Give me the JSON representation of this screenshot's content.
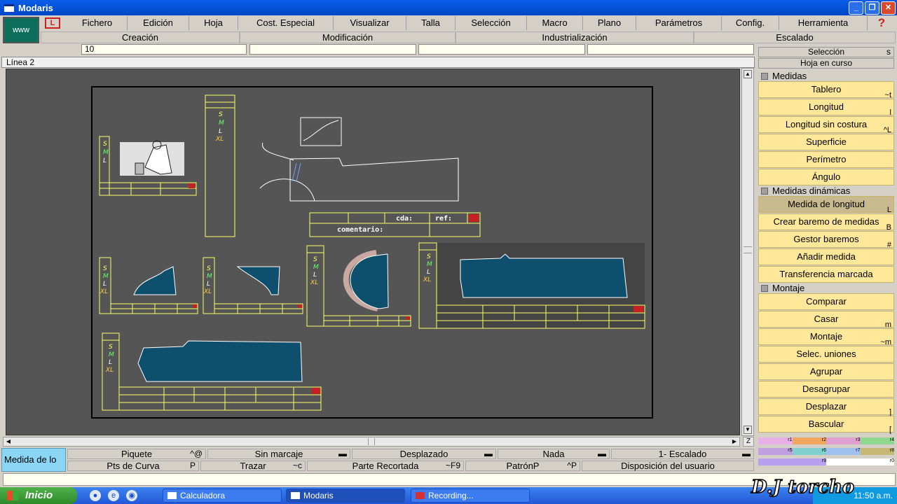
{
  "window": {
    "title": "Modaris",
    "www_label": "www",
    "lectra_glyph": "L"
  },
  "menu": [
    "Fichero",
    "Edición",
    "Hoja",
    "Cost. Especial",
    "Visualizar",
    "Talla",
    "Selección",
    "Macro",
    "Plano",
    "Parámetros",
    "Config.",
    "Herramienta"
  ],
  "help_glyph": "?",
  "submenu": [
    "Creación",
    "Modificación",
    "Industrialización",
    "Escalado"
  ],
  "fields": [
    "10",
    "",
    "",
    "",
    ""
  ],
  "line_label": "Línea 2",
  "right_panel": {
    "selection_label": "Selección",
    "selection_shortcut": "s",
    "sheet_label": "Hoja en curso",
    "sections": [
      {
        "title": "Medidas",
        "items": [
          {
            "label": "Tablero",
            "shortcut": "~t"
          },
          {
            "label": "Longitud",
            "shortcut": "l"
          },
          {
            "label": "Longitud sin costura",
            "shortcut": "^L"
          },
          {
            "label": "Superficie",
            "shortcut": ""
          },
          {
            "label": "Perímetro",
            "shortcut": ""
          },
          {
            "label": "Ángulo",
            "shortcut": ""
          }
        ]
      },
      {
        "title": "Medidas dinámicas",
        "items": [
          {
            "label": "Medida de longitud",
            "shortcut": "L",
            "active": true
          },
          {
            "label": "Crear baremo de medidas",
            "shortcut": "B"
          },
          {
            "label": "Gestor baremos",
            "shortcut": "#"
          },
          {
            "label": "Añadir medida",
            "shortcut": ""
          },
          {
            "label": "Transferencia marcada",
            "shortcut": ""
          }
        ]
      },
      {
        "title": "Montaje",
        "items": [
          {
            "label": "Comparar",
            "shortcut": ""
          },
          {
            "label": "Casar",
            "shortcut": "m"
          },
          {
            "label": "Montaje",
            "shortcut": "~m"
          },
          {
            "label": "Selec. uniones",
            "shortcut": ""
          },
          {
            "label": "Agrupar",
            "shortcut": ""
          },
          {
            "label": "Desagrupar",
            "shortcut": ""
          },
          {
            "label": "Desplazar",
            "shortcut": "]"
          },
          {
            "label": "Bascular",
            "shortcut": "["
          }
        ]
      }
    ]
  },
  "canvas": {
    "sizes": [
      "S",
      "M",
      "L",
      "XL"
    ],
    "title_block": {
      "cda_label": "cda:",
      "ref_label": "ref:",
      "comment_label": "comentario:"
    }
  },
  "status": {
    "current_function": "Medida de lo"
  },
  "options_row1": [
    {
      "label": "Piquete",
      "shortcut": "^@"
    },
    {
      "label": "Sin marcaje",
      "shortcut": ""
    },
    {
      "label": "Desplazado",
      "shortcut": ""
    },
    {
      "label": "Nada",
      "shortcut": ""
    },
    {
      "label": "1- Escalado",
      "shortcut": ""
    }
  ],
  "options_row2": [
    {
      "label": "Pts de Curva",
      "shortcut": "P"
    },
    {
      "label": "Trazar",
      "shortcut": "~c"
    },
    {
      "label": "Parte Recortada",
      "shortcut": "~F9"
    },
    {
      "label": "PatrónP",
      "shortcut": "^P"
    },
    {
      "label": "Disposición del usuario",
      "shortcut": ""
    }
  ],
  "color_bars": {
    "row1": [
      "r1",
      "r2",
      "r3",
      "r4"
    ],
    "row2": [
      "r5",
      "r6",
      "r7",
      "r8"
    ],
    "row3": [
      "r9",
      "r0"
    ]
  },
  "taskbar": {
    "start_label": "Inicio",
    "tasks": [
      "Calculadora",
      "Modaris",
      "Recording..."
    ],
    "clock": "11:50 a.m."
  },
  "watermark": "D.J torcho",
  "colors": {
    "canvas": "#555555",
    "piece_fill": "#0f4f6e",
    "frame": "#ffff66",
    "button_yellow": "#ffe89a",
    "titlebar": "#0a5de8"
  }
}
